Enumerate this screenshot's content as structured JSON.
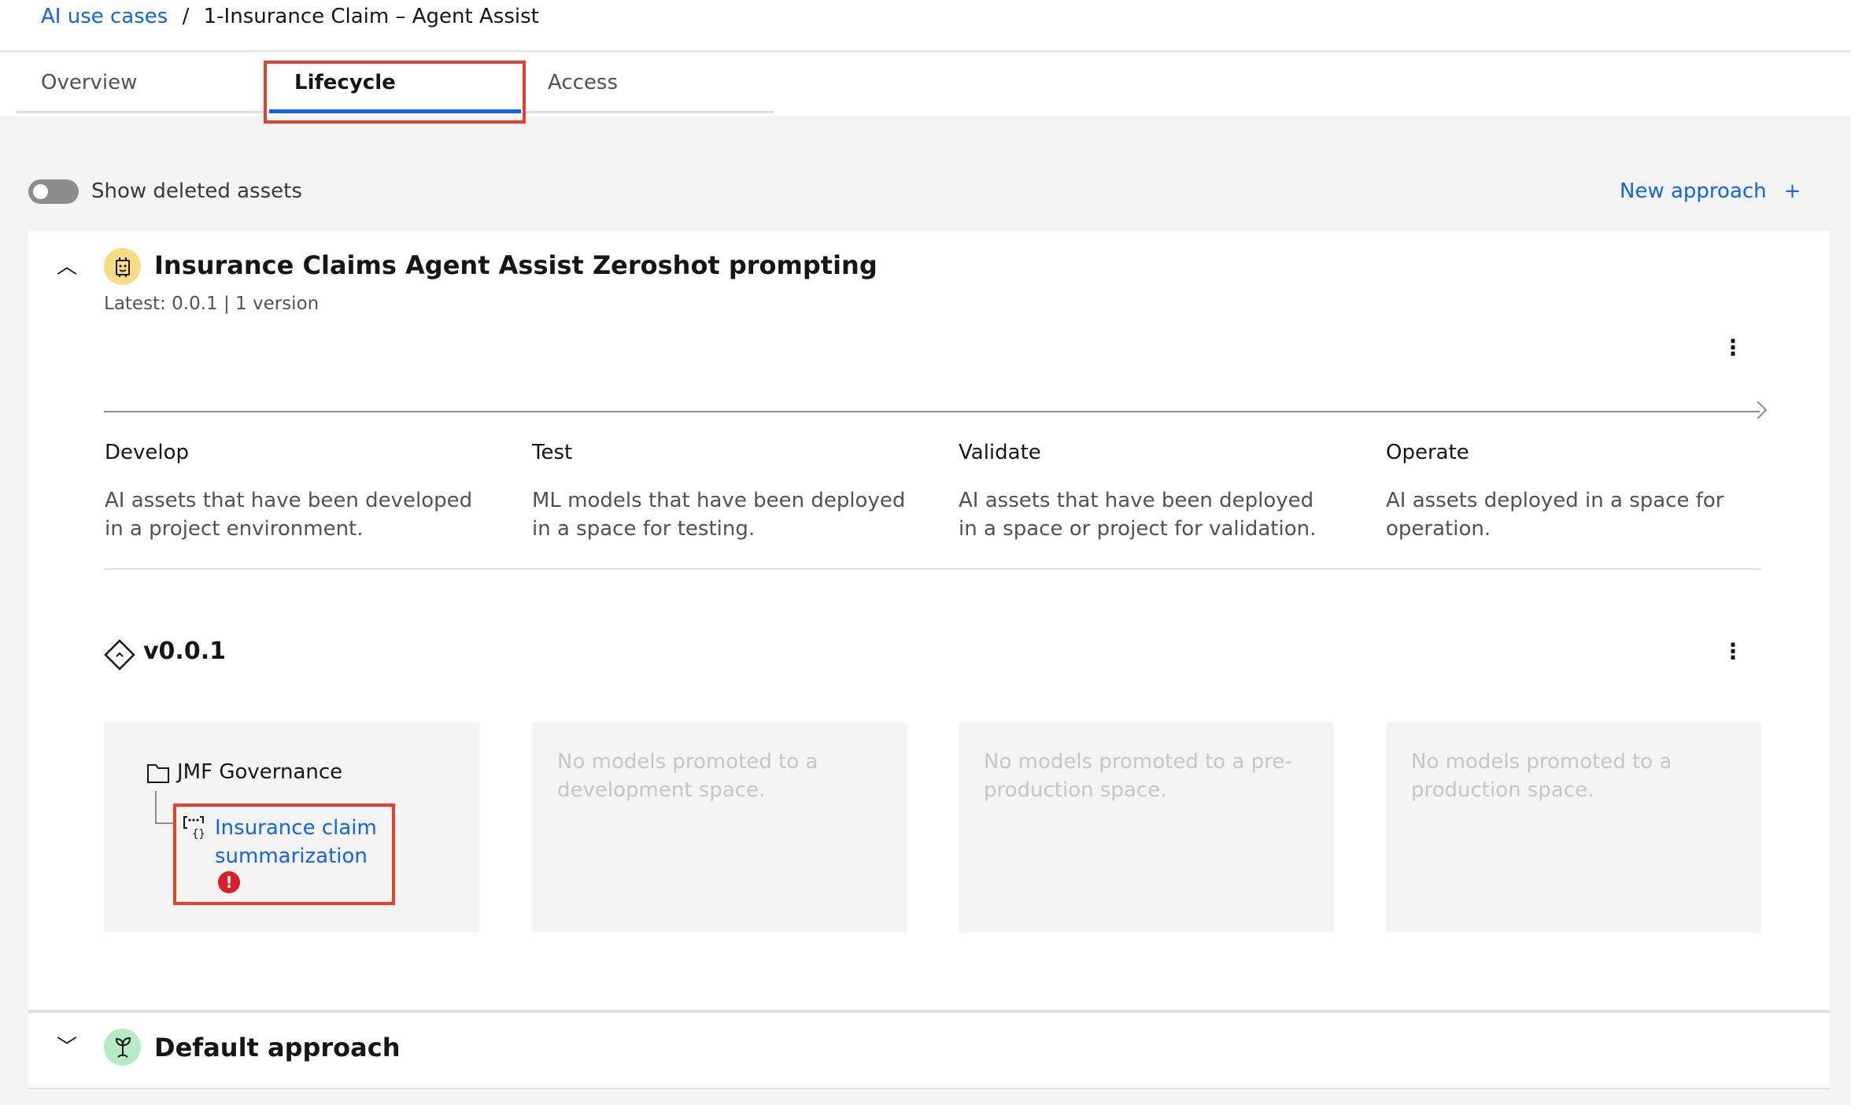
{
  "breadcrumb": {
    "parent": "AI use cases",
    "separator": "/",
    "current": "1-Insurance Claim – Agent Assist"
  },
  "tabs": [
    {
      "label": "Overview"
    },
    {
      "label": "Lifecycle",
      "active": true
    },
    {
      "label": "Access"
    }
  ],
  "toolbar": {
    "toggle_label": "Show deleted assets",
    "toggle_on": false,
    "new_approach": "New approach",
    "plus": "+"
  },
  "approaches": [
    {
      "title": "Insurance Claims Agent Assist Zeroshot prompting",
      "icon": "bot-icon",
      "icon_color": "#f8dc84",
      "expanded": true,
      "latest": "Latest: 0.0.1 | 1 version"
    },
    {
      "title": "Default approach",
      "icon": "sprout-icon",
      "icon_color": "#b5ecc3",
      "expanded": false
    }
  ],
  "stages": [
    {
      "title": "Develop",
      "desc": "AI assets that have been developed in a project environment."
    },
    {
      "title": "Test",
      "desc": "ML models that have been deployed in a space for testing."
    },
    {
      "title": "Validate",
      "desc": "AI assets that have been deployed in a space or project for validation."
    },
    {
      "title": "Operate",
      "desc": "AI assets deployed in a space for operation."
    }
  ],
  "version": {
    "label": "v0.0.1",
    "develop": {
      "project": "JMF Governance",
      "asset": "Insurance claim summarization",
      "status": "error"
    },
    "test_empty": "No models promoted to a development space.",
    "validate_empty": "No models promoted to a pre-production space.",
    "operate_empty": "No models promoted to a production space."
  },
  "colors": {
    "link": "#0f62fe",
    "highlight": "#e5402a",
    "error": "#da1e28"
  }
}
